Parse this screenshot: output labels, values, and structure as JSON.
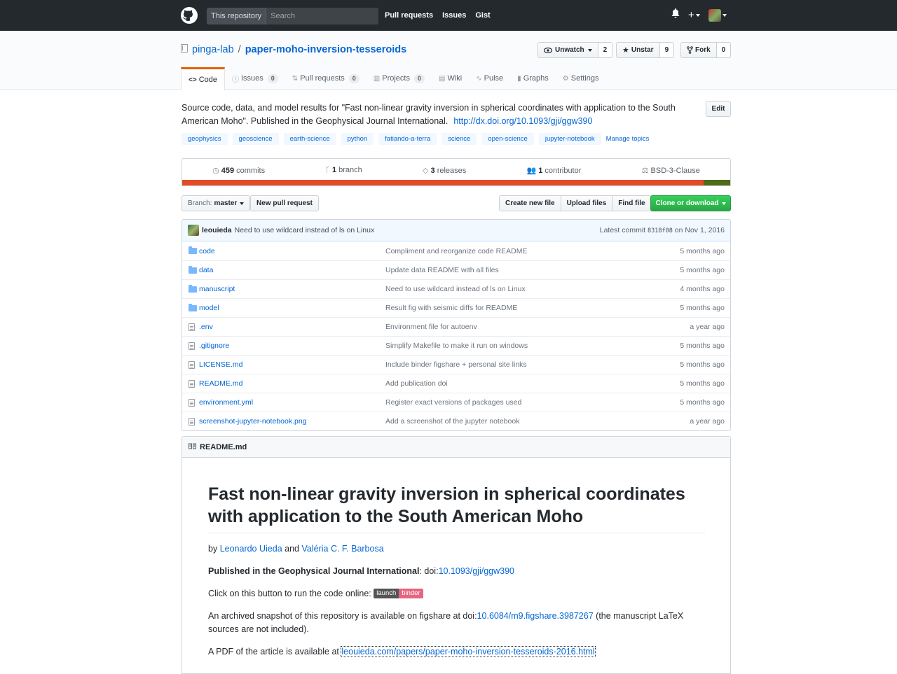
{
  "header": {
    "scope_label": "This repository",
    "search_placeholder": "Search",
    "nav": [
      "Pull requests",
      "Issues",
      "Gist"
    ]
  },
  "repo": {
    "owner": "pinga-lab",
    "separator": "/",
    "name": "paper-moho-inversion-tesseroids",
    "actions": [
      {
        "label": "Unwatch",
        "count": "2"
      },
      {
        "label": "Unstar",
        "count": "9"
      },
      {
        "label": "Fork",
        "count": "0"
      }
    ],
    "tabs": [
      {
        "label": "Code",
        "count": null
      },
      {
        "label": "Issues",
        "count": "0"
      },
      {
        "label": "Pull requests",
        "count": "0"
      },
      {
        "label": "Projects",
        "count": "0"
      },
      {
        "label": "Wiki",
        "count": null
      },
      {
        "label": "Pulse",
        "count": null
      },
      {
        "label": "Graphs",
        "count": null
      },
      {
        "label": "Settings",
        "count": null
      }
    ]
  },
  "description": {
    "text": "Source code, data, and model results for \"Fast non-linear gravity inversion in spherical coordinates with application to the South American Moho\". Published in the Geophysical Journal International.",
    "link": "http://dx.doi.org/10.1093/gji/ggw390",
    "edit_label": "Edit"
  },
  "topics": [
    "geophysics",
    "geoscience",
    "earth-science",
    "python",
    "fatiando-a-terra",
    "science",
    "open-science",
    "jupyter-notebook"
  ],
  "manage_topics": "Manage topics",
  "summary": {
    "commits_num": "459",
    "commits_label": "commits",
    "branch_num": "1",
    "branch_label": "branch",
    "releases_num": "3",
    "releases_label": "releases",
    "contributor_num": "1",
    "contributor_label": "contributor",
    "license": "BSD-3-Clause",
    "lang_colors": [
      "#e34c26",
      "#e36209",
      "#3572a5"
    ]
  },
  "filenav": {
    "branch_prefix": "Branch:",
    "branch": "master",
    "new_pr": "New pull request",
    "buttons": [
      "Create new file",
      "Upload files",
      "Find file"
    ],
    "clone": "Clone or download"
  },
  "latest_commit": {
    "author": "leouieda",
    "message": "Need to use wildcard instead of ls on Linux",
    "prefix": "Latest commit",
    "sha": "8318f08",
    "date": "on Nov 1, 2016"
  },
  "files": [
    {
      "type": "dir",
      "name": "code",
      "message": "Compliment and reorganize code README",
      "age": "5 months ago"
    },
    {
      "type": "dir",
      "name": "data",
      "message": "Update data README with all files",
      "age": "5 months ago"
    },
    {
      "type": "dir",
      "name": "manuscript",
      "message": "Need to use wildcard instead of ls on Linux",
      "age": "4 months ago"
    },
    {
      "type": "dir",
      "name": "model",
      "message": "Result fig with seismic diffs for README",
      "age": "5 months ago"
    },
    {
      "type": "file",
      "name": ".env",
      "message": "Environment file for autoenv",
      "age": "a year ago"
    },
    {
      "type": "file",
      "name": ".gitignore",
      "message": "Simplify Makefile to make it run on windows",
      "age": "5 months ago"
    },
    {
      "type": "file",
      "name": "LICENSE.md",
      "message": "Include binder figshare + personal site links",
      "age": "5 months ago"
    },
    {
      "type": "file",
      "name": "README.md",
      "message": "Add publication doi",
      "age": "5 months ago"
    },
    {
      "type": "file",
      "name": "environment.yml",
      "message": "Register exact versions of packages used",
      "age": "5 months ago"
    },
    {
      "type": "file",
      "name": "screenshot-jupyter-notebook.png",
      "message": "Add a screenshot of the jupyter notebook",
      "age": "a year ago"
    }
  ],
  "readme": {
    "filename": "README.md",
    "title": "Fast non-linear gravity inversion in spherical coordinates with application to the South American Moho",
    "by": "by",
    "author1": "Leonardo Uieda",
    "and": "and",
    "author2": "Valéria C. F. Barbosa",
    "pub_bold": "Published in the Geophysical Journal International",
    "pub_doi_prefix": ": doi:",
    "pub_doi": "10.1093/gji/ggw390",
    "run_text": "Click on this button to run the code online:",
    "binder_left": "launch",
    "binder_right": "binder",
    "archive_pre": "An archived snapshot of this repository is available on figshare at doi:",
    "archive_doi": "10.6084/m9.figshare.3987267",
    "archive_post": "(the manuscript LaTeX sources are not included).",
    "pdf_pre": "A PDF of the article is available at",
    "pdf_link": "leouieda.com/papers/paper-moho-inversion-tesseroids-2016.html"
  }
}
